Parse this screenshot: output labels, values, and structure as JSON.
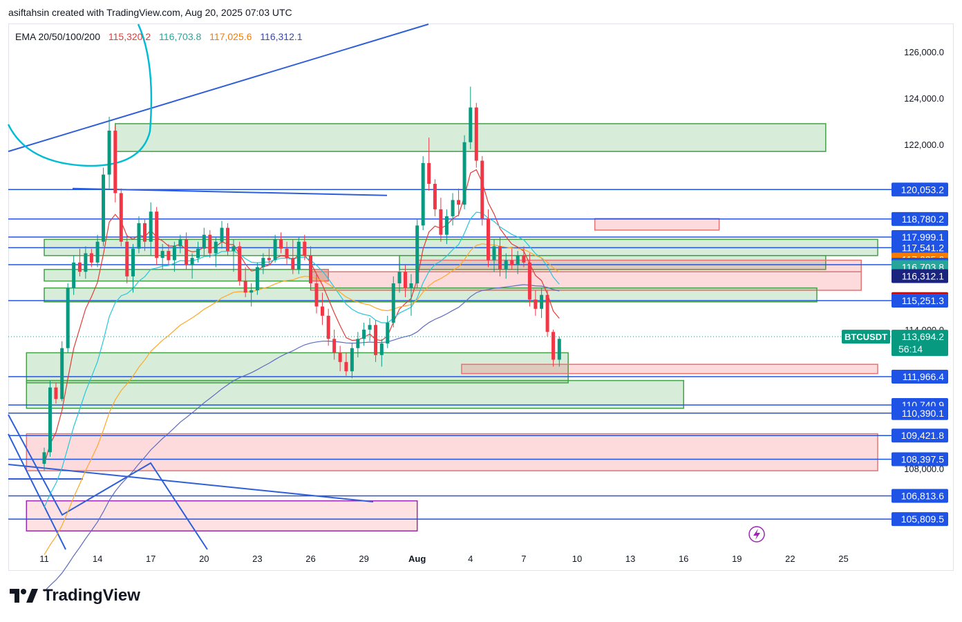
{
  "header": {
    "text": "asiftahsin created with TradingView.com, Aug 20, 2025 07:03 UTC"
  },
  "indicator": {
    "label": "EMA 20/50/100/200",
    "values": [
      {
        "text": "115,320.2",
        "color": "#e53935"
      },
      {
        "text": "116,703.8",
        "color": "#26a69a"
      },
      {
        "text": "117,025.6",
        "color": "#f57c00"
      },
      {
        "text": "116,312.1",
        "color": "#3949ab"
      }
    ]
  },
  "symbol": {
    "ticker": "BTCUSDT",
    "price": "113,694.2",
    "countdown": "56:14"
  },
  "logo": {
    "text": "TradingView"
  },
  "chart_data": {
    "type": "candlestick",
    "y_axis_ticks": [
      "126,000.0",
      "124,000.0",
      "122,000.0",
      "114,000.0",
      "108,000.0"
    ],
    "x_axis_ticks": [
      "11",
      "14",
      "17",
      "20",
      "23",
      "26",
      "29",
      "Aug",
      "4",
      "7",
      "10",
      "13",
      "16",
      "19",
      "22",
      "25"
    ],
    "ylim": [
      104500,
      127200
    ],
    "horizontal_levels": [
      {
        "value": 120053.2,
        "text": "120,053.2",
        "bg": "#1e53e5",
        "fg": "#ffffff"
      },
      {
        "value": 118780.2,
        "text": "118,780.2",
        "bg": "#1e53e5",
        "fg": "#ffffff"
      },
      {
        "value": 117999.1,
        "text": "117,999.1",
        "bg": "#1e53e5",
        "fg": "#ffffff"
      },
      {
        "value": 117541.2,
        "text": "117,541.2",
        "bg": "#1e53e5",
        "fg": "#ffffff"
      },
      {
        "value": 117025.6,
        "text": "117,025.6",
        "bg": "#f57c00",
        "fg": "#ffffff"
      },
      {
        "value": 116806.0,
        "text": "116,806.0",
        "bg": "#1e53e5",
        "fg": "#ffffff"
      },
      {
        "value": 116703.8,
        "text": "116,703.8",
        "bg": "#26a69a",
        "fg": "#ffffff"
      },
      {
        "value": 116312.1,
        "text": "116,312.1",
        "bg": "#1a237e",
        "fg": "#ffffff"
      },
      {
        "value": 115320.2,
        "text": "115,320.2",
        "bg": "#e00000",
        "fg": "#ffffff"
      },
      {
        "value": 115251.3,
        "text": "115,251.3",
        "bg": "#1e53e5",
        "fg": "#ffffff"
      },
      {
        "value": 111966.4,
        "text": "111,966.4",
        "bg": "#1e53e5",
        "fg": "#ffffff"
      },
      {
        "value": 110740.9,
        "text": "110,740.9",
        "bg": "#1e53e5",
        "fg": "#ffffff"
      },
      {
        "value": 110390.1,
        "text": "110,390.1",
        "bg": "#1e53e5",
        "fg": "#ffffff"
      },
      {
        "value": 109421.8,
        "text": "109,421.8",
        "bg": "#1e53e5",
        "fg": "#ffffff"
      },
      {
        "value": 108397.5,
        "text": "108,397.5",
        "bg": "#1e53e5",
        "fg": "#ffffff"
      },
      {
        "value": 106813.6,
        "text": "106,813.6",
        "bg": "#1e53e5",
        "fg": "#ffffff"
      },
      {
        "value": 105809.5,
        "text": "105,809.5",
        "bg": "#1e53e5",
        "fg": "#ffffff"
      }
    ],
    "zones": [
      {
        "x0": 4,
        "x1": 44,
        "top": 122900,
        "bottom": 121700,
        "kind": "green"
      },
      {
        "x0": 0,
        "x1": 47,
        "top": 117900,
        "bottom": 117200,
        "kind": "green"
      },
      {
        "x0": 0,
        "x1": 16,
        "top": 116600,
        "bottom": 116100,
        "kind": "green"
      },
      {
        "x0": 15,
        "x1": 16,
        "top": 116600,
        "bottom": 116100,
        "kind": "pink"
      },
      {
        "x0": 20,
        "x1": 44,
        "top": 117200,
        "bottom": 116600,
        "kind": "green"
      },
      {
        "x0": 21,
        "x1": 46,
        "top": 117000,
        "bottom": 116500,
        "kind": "pink"
      },
      {
        "x0": 15,
        "x1": 46,
        "top": 116500,
        "bottom": 115700,
        "kind": "pink"
      },
      {
        "x0": 31,
        "x1": 38,
        "top": 118800,
        "bottom": 118300,
        "kind": "pink"
      },
      {
        "x0": 0,
        "x1": 43.5,
        "top": 115800,
        "bottom": 115200,
        "kind": "green"
      },
      {
        "x0": -1,
        "x1": 29.5,
        "top": 113000,
        "bottom": 111700,
        "kind": "green"
      },
      {
        "x0": 23.5,
        "x1": 49,
        "top": 112500,
        "bottom": 112100,
        "kind": "pink"
      },
      {
        "x0": -1,
        "x1": 36,
        "top": 111800,
        "bottom": 110600,
        "kind": "green"
      },
      {
        "x0": -1,
        "x1": 49,
        "top": 109500,
        "bottom": 107900,
        "kind": "pink"
      },
      {
        "x0": -1,
        "x1": 21,
        "top": 106600,
        "bottom": 105300,
        "kind": "purple"
      }
    ],
    "ema_series": [
      {
        "name": "EMA 20",
        "color": "#e53935"
      },
      {
        "name": "EMA 50",
        "color": "#26c6da"
      },
      {
        "name": "EMA 100",
        "color": "#ffa726"
      },
      {
        "name": "EMA 200",
        "color": "#5c6bc0"
      }
    ],
    "candles": [
      {
        "d": 0,
        "o": 108200,
        "h": 108900,
        "l": 107900,
        "c": 108700
      },
      {
        "d": 0.33,
        "o": 108700,
        "h": 111800,
        "l": 108500,
        "c": 111500
      },
      {
        "d": 0.66,
        "o": 111500,
        "h": 111700,
        "l": 110800,
        "c": 111000
      },
      {
        "d": 1,
        "o": 111000,
        "h": 113500,
        "l": 110900,
        "c": 113200
      },
      {
        "d": 1.33,
        "o": 113200,
        "h": 116000,
        "l": 113000,
        "c": 115800
      },
      {
        "d": 1.66,
        "o": 115800,
        "h": 117200,
        "l": 115500,
        "c": 116900
      },
      {
        "d": 2,
        "o": 116900,
        "h": 117500,
        "l": 116300,
        "c": 116500
      },
      {
        "d": 2.33,
        "o": 116500,
        "h": 117600,
        "l": 116200,
        "c": 117300
      },
      {
        "d": 2.66,
        "o": 117300,
        "h": 117500,
        "l": 116700,
        "c": 116900
      },
      {
        "d": 3,
        "o": 116900,
        "h": 118100,
        "l": 116700,
        "c": 117800
      },
      {
        "d": 3.33,
        "o": 117800,
        "h": 121000,
        "l": 117600,
        "c": 120700
      },
      {
        "d": 3.66,
        "o": 120700,
        "h": 123200,
        "l": 120100,
        "c": 122600
      },
      {
        "d": 4,
        "o": 122600,
        "h": 122800,
        "l": 119500,
        "c": 119900
      },
      {
        "d": 4.33,
        "o": 119900,
        "h": 120100,
        "l": 117600,
        "c": 117800
      },
      {
        "d": 4.66,
        "o": 117800,
        "h": 118100,
        "l": 116000,
        "c": 116300
      },
      {
        "d": 5,
        "o": 116300,
        "h": 117700,
        "l": 115600,
        "c": 117500
      },
      {
        "d": 5.33,
        "o": 117500,
        "h": 118900,
        "l": 117300,
        "c": 118600
      },
      {
        "d": 5.66,
        "o": 118600,
        "h": 118800,
        "l": 117400,
        "c": 117800
      },
      {
        "d": 6,
        "o": 117800,
        "h": 119500,
        "l": 117200,
        "c": 119100
      },
      {
        "d": 6.33,
        "o": 119100,
        "h": 119300,
        "l": 116800,
        "c": 117100
      },
      {
        "d": 6.66,
        "o": 117100,
        "h": 117700,
        "l": 116600,
        "c": 117400
      },
      {
        "d": 7,
        "o": 117400,
        "h": 117700,
        "l": 116800,
        "c": 117000
      },
      {
        "d": 7.33,
        "o": 117000,
        "h": 117800,
        "l": 116500,
        "c": 117600
      },
      {
        "d": 7.66,
        "o": 117600,
        "h": 118100,
        "l": 117300,
        "c": 117900
      },
      {
        "d": 8,
        "o": 117900,
        "h": 118200,
        "l": 116600,
        "c": 116800
      },
      {
        "d": 8.33,
        "o": 116800,
        "h": 117300,
        "l": 116200,
        "c": 117100
      },
      {
        "d": 8.66,
        "o": 117100,
        "h": 117800,
        "l": 116900,
        "c": 117500
      },
      {
        "d": 9,
        "o": 117500,
        "h": 118400,
        "l": 117200,
        "c": 118100
      },
      {
        "d": 9.33,
        "o": 118100,
        "h": 118300,
        "l": 117100,
        "c": 117300
      },
      {
        "d": 9.66,
        "o": 117300,
        "h": 118000,
        "l": 116700,
        "c": 117800
      },
      {
        "d": 10,
        "o": 117800,
        "h": 118700,
        "l": 117500,
        "c": 118400
      },
      {
        "d": 10.33,
        "o": 118400,
        "h": 118600,
        "l": 117200,
        "c": 117400
      },
      {
        "d": 10.66,
        "o": 117400,
        "h": 117900,
        "l": 116500,
        "c": 117600
      },
      {
        "d": 11,
        "o": 117600,
        "h": 117800,
        "l": 115900,
        "c": 116100
      },
      {
        "d": 11.33,
        "o": 116100,
        "h": 116700,
        "l": 115400,
        "c": 115600
      },
      {
        "d": 11.66,
        "o": 115600,
        "h": 116000,
        "l": 115000,
        "c": 115700
      },
      {
        "d": 12,
        "o": 115700,
        "h": 116900,
        "l": 115500,
        "c": 116700
      },
      {
        "d": 12.33,
        "o": 116700,
        "h": 117300,
        "l": 116400,
        "c": 117100
      },
      {
        "d": 12.66,
        "o": 117100,
        "h": 117500,
        "l": 116800,
        "c": 117000
      },
      {
        "d": 13,
        "o": 117000,
        "h": 118100,
        "l": 116900,
        "c": 117900
      },
      {
        "d": 13.33,
        "o": 117900,
        "h": 118200,
        "l": 117300,
        "c": 117500
      },
      {
        "d": 13.66,
        "o": 117500,
        "h": 117800,
        "l": 116800,
        "c": 117100
      },
      {
        "d": 14,
        "o": 117100,
        "h": 117900,
        "l": 116400,
        "c": 116600
      },
      {
        "d": 14.33,
        "o": 116600,
        "h": 118000,
        "l": 116400,
        "c": 117800
      },
      {
        "d": 14.66,
        "o": 117800,
        "h": 118100,
        "l": 117000,
        "c": 117200
      },
      {
        "d": 15,
        "o": 117200,
        "h": 117600,
        "l": 115700,
        "c": 116000
      },
      {
        "d": 15.33,
        "o": 116000,
        "h": 116400,
        "l": 114700,
        "c": 115000
      },
      {
        "d": 15.66,
        "o": 115000,
        "h": 115600,
        "l": 114200,
        "c": 114600
      },
      {
        "d": 16,
        "o": 114600,
        "h": 114900,
        "l": 113300,
        "c": 113600
      },
      {
        "d": 16.33,
        "o": 113600,
        "h": 114000,
        "l": 112700,
        "c": 113000
      },
      {
        "d": 16.66,
        "o": 113000,
        "h": 113300,
        "l": 112200,
        "c": 112600
      },
      {
        "d": 17,
        "o": 112600,
        "h": 113000,
        "l": 112000,
        "c": 112200
      },
      {
        "d": 17.33,
        "o": 112200,
        "h": 113400,
        "l": 111900,
        "c": 113200
      },
      {
        "d": 17.66,
        "o": 113200,
        "h": 113900,
        "l": 112800,
        "c": 113600
      },
      {
        "d": 18,
        "o": 113600,
        "h": 114300,
        "l": 113300,
        "c": 114000
      },
      {
        "d": 18.33,
        "o": 114000,
        "h": 114500,
        "l": 113500,
        "c": 114200
      },
      {
        "d": 18.66,
        "o": 114200,
        "h": 114400,
        "l": 112600,
        "c": 112900
      },
      {
        "d": 19,
        "o": 112900,
        "h": 113600,
        "l": 112400,
        "c": 113400
      },
      {
        "d": 19.33,
        "o": 113400,
        "h": 114600,
        "l": 113200,
        "c": 114300
      },
      {
        "d": 19.66,
        "o": 114300,
        "h": 116300,
        "l": 114100,
        "c": 116000
      },
      {
        "d": 20,
        "o": 116000,
        "h": 116900,
        "l": 115600,
        "c": 116500
      },
      {
        "d": 20.33,
        "o": 116500,
        "h": 116800,
        "l": 115400,
        "c": 115800
      },
      {
        "d": 20.66,
        "o": 115800,
        "h": 116400,
        "l": 114600,
        "c": 116000
      },
      {
        "d": 21,
        "o": 116000,
        "h": 118800,
        "l": 115800,
        "c": 118500
      },
      {
        "d": 21.33,
        "o": 118500,
        "h": 121500,
        "l": 118300,
        "c": 121200
      },
      {
        "d": 21.66,
        "o": 121200,
        "h": 122300,
        "l": 120000,
        "c": 120300
      },
      {
        "d": 22,
        "o": 120300,
        "h": 120500,
        "l": 118900,
        "c": 119200
      },
      {
        "d": 22.33,
        "o": 119200,
        "h": 119700,
        "l": 117800,
        "c": 118100
      },
      {
        "d": 22.66,
        "o": 118100,
        "h": 119200,
        "l": 117700,
        "c": 118900
      },
      {
        "d": 23,
        "o": 118900,
        "h": 119900,
        "l": 118500,
        "c": 119600
      },
      {
        "d": 23.33,
        "o": 119600,
        "h": 120100,
        "l": 118900,
        "c": 119400
      },
      {
        "d": 23.66,
        "o": 119400,
        "h": 122400,
        "l": 119200,
        "c": 122100
      },
      {
        "d": 24,
        "o": 122100,
        "h": 124500,
        "l": 121800,
        "c": 123600
      },
      {
        "d": 24.33,
        "o": 123600,
        "h": 123800,
        "l": 121000,
        "c": 121300
      },
      {
        "d": 24.66,
        "o": 121300,
        "h": 121500,
        "l": 118500,
        "c": 118800
      },
      {
        "d": 25,
        "o": 118800,
        "h": 119200,
        "l": 116700,
        "c": 117000
      },
      {
        "d": 25.33,
        "o": 117000,
        "h": 117900,
        "l": 116500,
        "c": 117600
      },
      {
        "d": 25.66,
        "o": 117600,
        "h": 118000,
        "l": 116300,
        "c": 116600
      },
      {
        "d": 26,
        "o": 116600,
        "h": 117300,
        "l": 116200,
        "c": 117000
      },
      {
        "d": 26.33,
        "o": 117000,
        "h": 117500,
        "l": 116600,
        "c": 116800
      },
      {
        "d": 26.66,
        "o": 116800,
        "h": 117400,
        "l": 116400,
        "c": 117200
      },
      {
        "d": 27,
        "o": 117200,
        "h": 117600,
        "l": 116700,
        "c": 116900
      },
      {
        "d": 27.33,
        "o": 116900,
        "h": 117300,
        "l": 115000,
        "c": 115300
      },
      {
        "d": 27.66,
        "o": 115300,
        "h": 115700,
        "l": 114600,
        "c": 114900
      },
      {
        "d": 28,
        "o": 114900,
        "h": 115800,
        "l": 114500,
        "c": 115500
      },
      {
        "d": 28.33,
        "o": 115500,
        "h": 115700,
        "l": 113700,
        "c": 113900
      },
      {
        "d": 28.66,
        "o": 113900,
        "h": 114000,
        "l": 112400,
        "c": 112700
      },
      {
        "d": 29,
        "o": 112700,
        "h": 113700,
        "l": 112400,
        "c": 113600
      }
    ]
  }
}
